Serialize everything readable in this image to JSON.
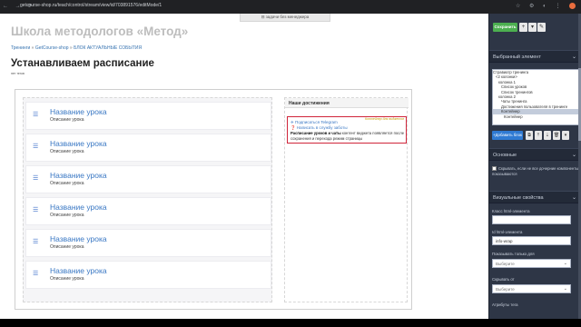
{
  "browser": {
    "url": "getcourse-shop.ru/teach/control/stream/view/id/703891576/editMode/1",
    "nav_icons": "← → ⟳",
    "ext_icons": "☆ ⚙ ◐ ⋮"
  },
  "notice": {
    "text": "⊟ задачи без менеджера"
  },
  "header": {
    "school_title": "Школа методологов «Метод»",
    "breadcrumb": [
      "Тренинги",
      "GetCourse-shop",
      "БЛОК АКТУАЛЬНЫЕ СОБЫТИЯ"
    ],
    "breadcrumb_sep": "»",
    "page_title": "Устанавливаем расписание",
    "page_sub": "нет тегов"
  },
  "lessons": [
    {
      "title": "Название урока",
      "desc": "Описание урока"
    },
    {
      "title": "Название урока",
      "desc": "Описание урока"
    },
    {
      "title": "Название урока",
      "desc": "Описание урока"
    },
    {
      "title": "Название урока",
      "desc": "Описание урока"
    },
    {
      "title": "Название урока",
      "desc": "Описание урока"
    },
    {
      "title": "Название урока",
      "desc": "Описание урока"
    }
  ],
  "lesson_icon": "list-icon",
  "right_block": {
    "header": "Наши достижения",
    "selected_tag": "Контейнер для виджетов",
    "link_telegram": "Подписаться Telegram",
    "link_support": "Написать в службу заботы",
    "text_bold": "Расписание уроков и чаты",
    "text_rest": "контент виджета появляется после сохранения и перехода режим страницы"
  },
  "sidebar": {
    "save_label": "Сохранить",
    "btn_plus": "+",
    "btn_more": "▾",
    "btn_edit": "✎",
    "sections": {
      "selected": "Выбранный элемент",
      "basic": "Основные",
      "visual": "Визуальные свойства"
    },
    "chevron": "⌄",
    "tree": [
      "Стравиатр тренинга",
      "<2 колонки>",
      "колонка 1",
      "Список уроков",
      "Список тренингов",
      "колонка 2",
      "Чаты тренинга",
      "Достижения пользователя в тренинге",
      "Контейнер",
      "Контейнер"
    ],
    "tree_selected_index": 8,
    "add_btn": "+Добавить блок",
    "mini_btns": [
      "⧉",
      "⇡",
      "⇣",
      "🗑",
      "▾"
    ],
    "checkbox_label": "Скрывать, если не все дочерние компоненты показываются",
    "fields": {
      "class_label": "Класс html-элемента",
      "class_value": "",
      "id_label": "Id html-элемента",
      "id_value": "info-wrap",
      "show_label": "Показывать только для",
      "show_placeholder": "Выберите",
      "hide_label": "Скрывать от",
      "hide_placeholder": "Выберите",
      "attr_label": "Атрибуты тега"
    }
  }
}
